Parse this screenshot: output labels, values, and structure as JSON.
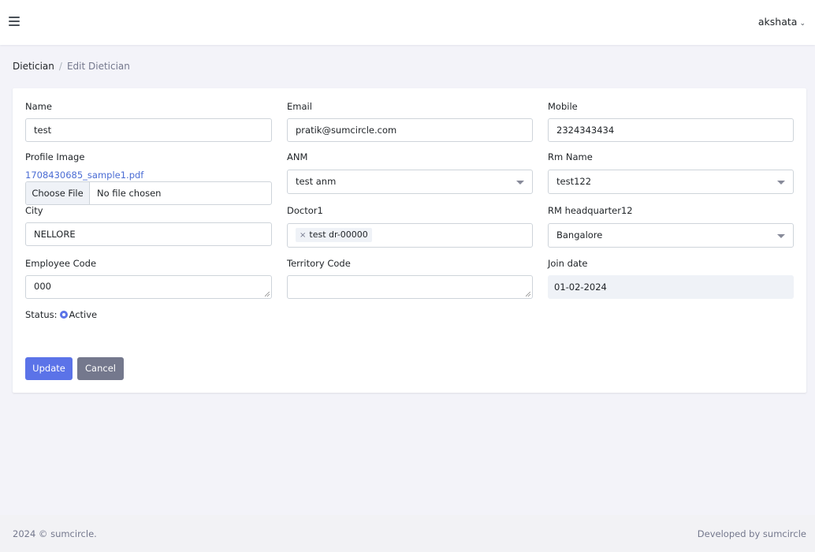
{
  "header": {
    "user_name": "akshata"
  },
  "breadcrumb": {
    "parent": "Dietician",
    "separator": "/",
    "current": "Edit Dietician"
  },
  "form": {
    "name": {
      "label": "Name",
      "value": "test"
    },
    "email": {
      "label": "Email",
      "value": "pratik@sumcircle.com"
    },
    "mobile": {
      "label": "Mobile",
      "value": "2324343434"
    },
    "profile_image": {
      "label": "Profile Image",
      "current_file": "1708430685_sample1.pdf",
      "button_label": "Choose File",
      "file_status": "No file chosen"
    },
    "anm": {
      "label": "ANM",
      "value": "test anm"
    },
    "rm_name": {
      "label": "Rm Name",
      "value": "test122"
    },
    "city": {
      "label": "City",
      "value": "NELLORE"
    },
    "doctor1": {
      "label": "Doctor1",
      "tags": [
        "test dr-00000"
      ]
    },
    "rm_headquarter": {
      "label": "RM headquarter12",
      "value": "Bangalore"
    },
    "employee_code": {
      "label": "Employee Code",
      "value": "000"
    },
    "territory_code": {
      "label": "Territory Code",
      "value": ""
    },
    "join_date": {
      "label": "Join date",
      "value": "01-02-2024"
    },
    "status": {
      "label": "Status:",
      "option": "Active",
      "checked": true
    }
  },
  "actions": {
    "update": "Update",
    "cancel": "Cancel"
  },
  "footer": {
    "copyright": "2024 © sumcircle.",
    "credit": "Developed by sumcircle"
  },
  "colors": {
    "primary": "#5b73e8",
    "secondary": "#74788d",
    "link": "#4a6cd4",
    "page_bg": "#f3f3f9"
  }
}
